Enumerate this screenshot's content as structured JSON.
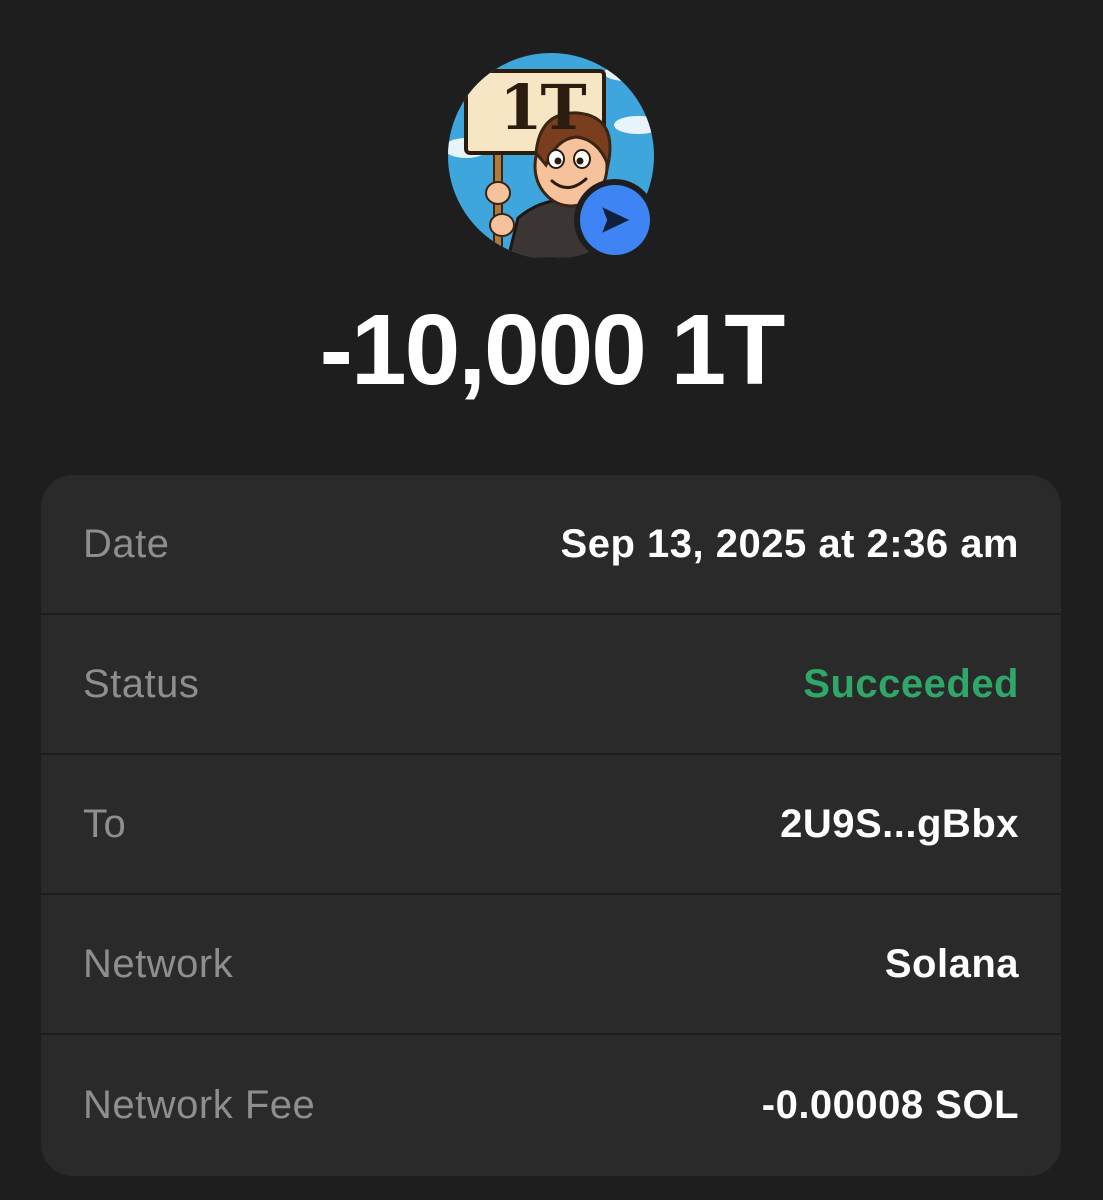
{
  "token": {
    "sign_text": "1T",
    "action_icon": "send-arrow-icon",
    "badge_color": "#3e84f4"
  },
  "amount": "-10,000 1T",
  "details": [
    {
      "label": "Date",
      "value": "Sep 13, 2025 at 2:36 am"
    },
    {
      "label": "Status",
      "value": "Succeeded",
      "value_color": "#2ea769"
    },
    {
      "label": "To",
      "value": "2U9S...gBbx"
    },
    {
      "label": "Network",
      "value": "Solana"
    },
    {
      "label": "Network Fee",
      "value": "-0.00008 SOL"
    }
  ]
}
